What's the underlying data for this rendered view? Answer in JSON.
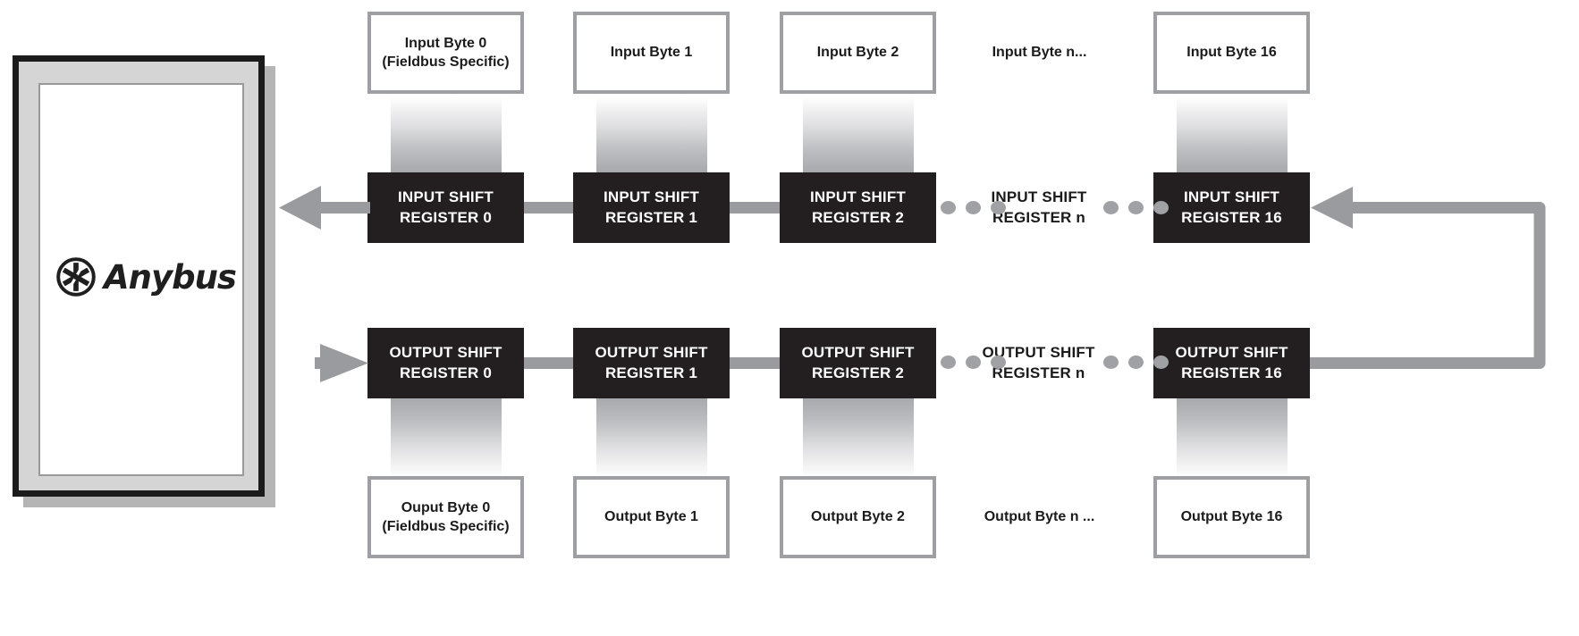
{
  "diagram": {
    "title": "Anybus shift register chain",
    "module": {
      "logo_label": "Anybus",
      "logo_icon": "anybus-asterisk-logo"
    },
    "colors": {
      "register_fill": "#231f20",
      "register_text": "#ffffff",
      "byte_border": "#9d9fa2",
      "link": "#9a9b9f",
      "module_border": "#1b1b1b",
      "module_fill": "#d5d5d5"
    },
    "input_bytes": [
      {
        "line1": "Input Byte 0",
        "line2": "(Fieldbus Specific)",
        "boxed": true
      },
      {
        "line1": "Input Byte 1",
        "line2": "",
        "boxed": true
      },
      {
        "line1": "Input Byte 2",
        "line2": "",
        "boxed": true
      },
      {
        "line1": "Input Byte n...",
        "line2": "",
        "boxed": false
      },
      {
        "line1": "Input Byte 16",
        "line2": "",
        "boxed": true
      }
    ],
    "input_registers": [
      {
        "line1": "INPUT SHIFT",
        "line2": "REGISTER 0",
        "boxed": true
      },
      {
        "line1": "INPUT SHIFT",
        "line2": "REGISTER 1",
        "boxed": true
      },
      {
        "line1": "INPUT SHIFT",
        "line2": "REGISTER 2",
        "boxed": true
      },
      {
        "line1": "INPUT SHIFT",
        "line2": "REGISTER n",
        "boxed": false
      },
      {
        "line1": "INPUT SHIFT",
        "line2": "REGISTER 16",
        "boxed": true
      }
    ],
    "output_registers": [
      {
        "line1": "OUTPUT SHIFT",
        "line2": "REGISTER 0",
        "boxed": true
      },
      {
        "line1": "OUTPUT SHIFT",
        "line2": "REGISTER 1",
        "boxed": true
      },
      {
        "line1": "OUTPUT SHIFT",
        "line2": "REGISTER 2",
        "boxed": true
      },
      {
        "line1": "OUTPUT SHIFT",
        "line2": "REGISTER n",
        "boxed": false
      },
      {
        "line1": "OUTPUT SHIFT",
        "line2": "REGISTER 16",
        "boxed": true
      }
    ],
    "output_bytes": [
      {
        "line1": "Ouput Byte 0",
        "line2": "(Fieldbus Specific)",
        "boxed": true
      },
      {
        "line1": "Output Byte 1",
        "line2": "",
        "boxed": true
      },
      {
        "line1": "Output Byte 2",
        "line2": "",
        "boxed": true
      },
      {
        "line1": "Output Byte n ...",
        "line2": "",
        "boxed": false
      },
      {
        "line1": "Output Byte 16",
        "line2": "",
        "boxed": true
      }
    ]
  }
}
